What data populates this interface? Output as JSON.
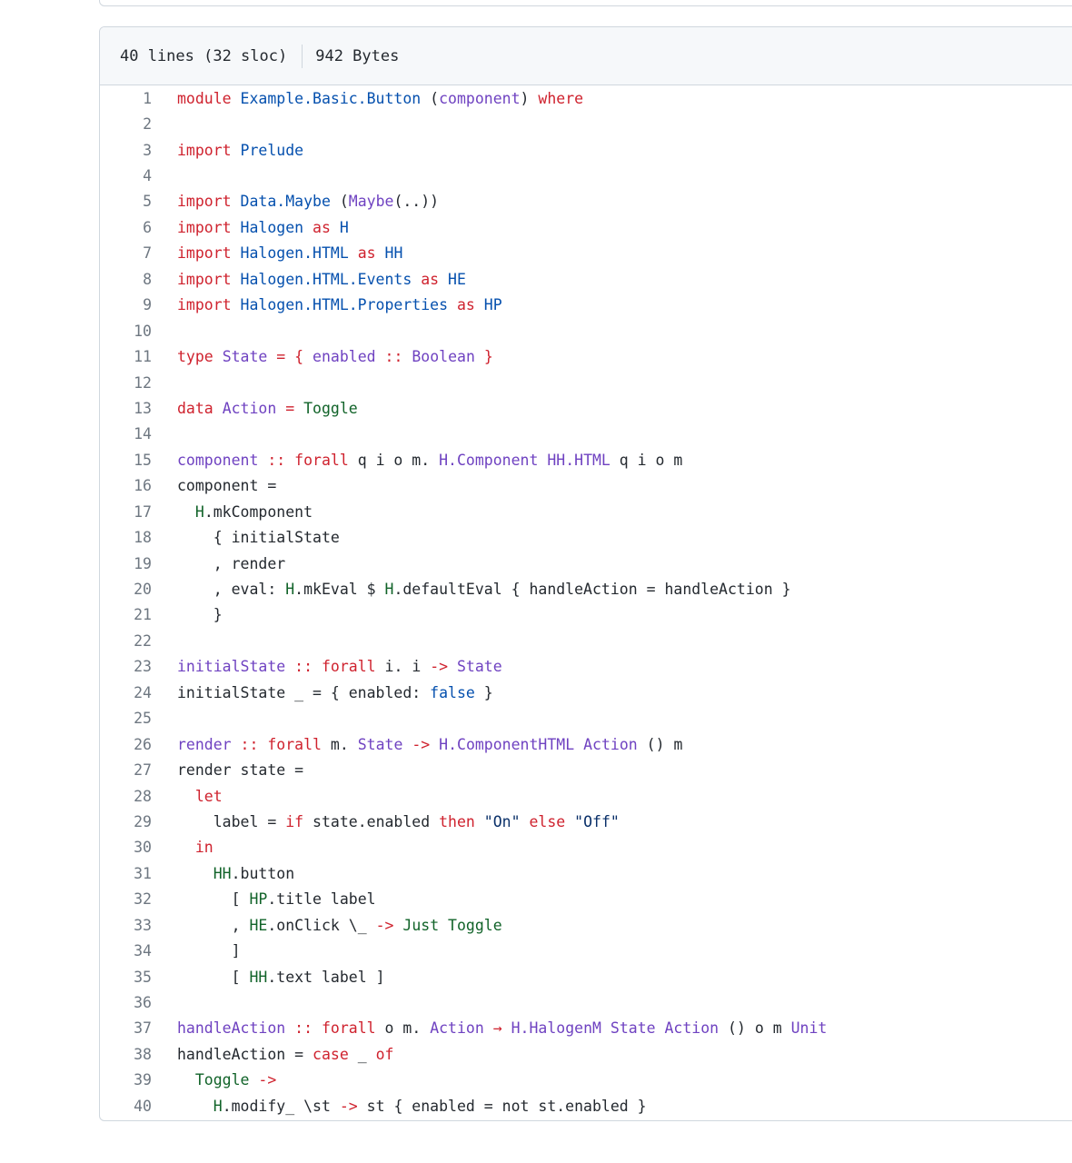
{
  "file_info": {
    "lines_text": "40 lines (32 sloc)",
    "size_text": "942 Bytes"
  },
  "colors": {
    "keyword": "#cf222e",
    "type": "#6f42c1",
    "module": "#0550ae",
    "constructor": "#116329",
    "string": "#0a3069",
    "plain": "#24292f",
    "line_number": "#6e7781"
  },
  "code_lines": [
    {
      "n": "1",
      "tokens": [
        [
          "kw",
          "module"
        ],
        [
          "pl",
          " "
        ],
        [
          "mod",
          "Example.Basic.Button"
        ],
        [
          "pl",
          " ("
        ],
        [
          "ty",
          "component"
        ],
        [
          "pl",
          ") "
        ],
        [
          "kw",
          "where"
        ]
      ]
    },
    {
      "n": "2",
      "tokens": []
    },
    {
      "n": "3",
      "tokens": [
        [
          "kw",
          "import"
        ],
        [
          "pl",
          " "
        ],
        [
          "mod",
          "Prelude"
        ]
      ]
    },
    {
      "n": "4",
      "tokens": []
    },
    {
      "n": "5",
      "tokens": [
        [
          "kw",
          "import"
        ],
        [
          "pl",
          " "
        ],
        [
          "mod",
          "Data.Maybe"
        ],
        [
          "pl",
          " ("
        ],
        [
          "ty",
          "Maybe"
        ],
        [
          "pl",
          "(..))"
        ]
      ]
    },
    {
      "n": "6",
      "tokens": [
        [
          "kw",
          "import"
        ],
        [
          "pl",
          " "
        ],
        [
          "mod",
          "Halogen"
        ],
        [
          "pl",
          " "
        ],
        [
          "kw",
          "as"
        ],
        [
          "pl",
          " "
        ],
        [
          "mod",
          "H"
        ]
      ]
    },
    {
      "n": "7",
      "tokens": [
        [
          "kw",
          "import"
        ],
        [
          "pl",
          " "
        ],
        [
          "mod",
          "Halogen.HTML"
        ],
        [
          "pl",
          " "
        ],
        [
          "kw",
          "as"
        ],
        [
          "pl",
          " "
        ],
        [
          "mod",
          "HH"
        ]
      ]
    },
    {
      "n": "8",
      "tokens": [
        [
          "kw",
          "import"
        ],
        [
          "pl",
          " "
        ],
        [
          "mod",
          "Halogen.HTML.Events"
        ],
        [
          "pl",
          " "
        ],
        [
          "kw",
          "as"
        ],
        [
          "pl",
          " "
        ],
        [
          "mod",
          "HE"
        ]
      ]
    },
    {
      "n": "9",
      "tokens": [
        [
          "kw",
          "import"
        ],
        [
          "pl",
          " "
        ],
        [
          "mod",
          "Halogen.HTML.Properties"
        ],
        [
          "pl",
          " "
        ],
        [
          "kw",
          "as"
        ],
        [
          "pl",
          " "
        ],
        [
          "mod",
          "HP"
        ]
      ]
    },
    {
      "n": "10",
      "tokens": []
    },
    {
      "n": "11",
      "tokens": [
        [
          "kw",
          "type"
        ],
        [
          "pl",
          " "
        ],
        [
          "ty",
          "State"
        ],
        [
          "pl",
          " "
        ],
        [
          "kw",
          "="
        ],
        [
          "pl",
          " "
        ],
        [
          "kw",
          "{"
        ],
        [
          "pl",
          " "
        ],
        [
          "ty",
          "enabled"
        ],
        [
          "pl",
          " "
        ],
        [
          "kw",
          "::"
        ],
        [
          "pl",
          " "
        ],
        [
          "ty",
          "Boolean"
        ],
        [
          "pl",
          " "
        ],
        [
          "kw",
          "}"
        ]
      ]
    },
    {
      "n": "12",
      "tokens": []
    },
    {
      "n": "13",
      "tokens": [
        [
          "kw",
          "data"
        ],
        [
          "pl",
          " "
        ],
        [
          "ty",
          "Action"
        ],
        [
          "pl",
          " "
        ],
        [
          "kw",
          "="
        ],
        [
          "pl",
          " "
        ],
        [
          "gr",
          "Toggle"
        ]
      ]
    },
    {
      "n": "14",
      "tokens": []
    },
    {
      "n": "15",
      "tokens": [
        [
          "ty",
          "component"
        ],
        [
          "pl",
          " "
        ],
        [
          "kw",
          "::"
        ],
        [
          "pl",
          " "
        ],
        [
          "kw",
          "forall"
        ],
        [
          "pl",
          " q i o m. "
        ],
        [
          "ty",
          "H.Component"
        ],
        [
          "pl",
          " "
        ],
        [
          "ty",
          "HH.HTML"
        ],
        [
          "pl",
          " q i o m"
        ]
      ]
    },
    {
      "n": "16",
      "tokens": [
        [
          "pl",
          "component ="
        ]
      ]
    },
    {
      "n": "17",
      "tokens": [
        [
          "pl",
          "  "
        ],
        [
          "gr",
          "H"
        ],
        [
          "pl",
          ".mkComponent"
        ]
      ]
    },
    {
      "n": "18",
      "tokens": [
        [
          "pl",
          "    { initialState"
        ]
      ]
    },
    {
      "n": "19",
      "tokens": [
        [
          "pl",
          "    , render"
        ]
      ]
    },
    {
      "n": "20",
      "tokens": [
        [
          "pl",
          "    , eval: "
        ],
        [
          "gr",
          "H"
        ],
        [
          "pl",
          ".mkEval $ "
        ],
        [
          "gr",
          "H"
        ],
        [
          "pl",
          ".defaultEval { handleAction = handleAction }"
        ]
      ]
    },
    {
      "n": "21",
      "tokens": [
        [
          "pl",
          "    }"
        ]
      ]
    },
    {
      "n": "22",
      "tokens": []
    },
    {
      "n": "23",
      "tokens": [
        [
          "ty",
          "initialState"
        ],
        [
          "pl",
          " "
        ],
        [
          "kw",
          "::"
        ],
        [
          "pl",
          " "
        ],
        [
          "kw",
          "forall"
        ],
        [
          "pl",
          " i. i "
        ],
        [
          "kw",
          "->"
        ],
        [
          "pl",
          " "
        ],
        [
          "ty",
          "State"
        ]
      ]
    },
    {
      "n": "24",
      "tokens": [
        [
          "pl",
          "initialState _ = { enabled: "
        ],
        [
          "mod",
          "false"
        ],
        [
          "pl",
          " }"
        ]
      ]
    },
    {
      "n": "25",
      "tokens": []
    },
    {
      "n": "26",
      "tokens": [
        [
          "ty",
          "render"
        ],
        [
          "pl",
          " "
        ],
        [
          "kw",
          "::"
        ],
        [
          "pl",
          " "
        ],
        [
          "kw",
          "forall"
        ],
        [
          "pl",
          " m. "
        ],
        [
          "ty",
          "State"
        ],
        [
          "pl",
          " "
        ],
        [
          "kw",
          "->"
        ],
        [
          "pl",
          " "
        ],
        [
          "ty",
          "H.ComponentHTML"
        ],
        [
          "pl",
          " "
        ],
        [
          "ty",
          "Action"
        ],
        [
          "pl",
          " () m"
        ]
      ]
    },
    {
      "n": "27",
      "tokens": [
        [
          "pl",
          "render state ="
        ]
      ]
    },
    {
      "n": "28",
      "tokens": [
        [
          "pl",
          "  "
        ],
        [
          "kw",
          "let"
        ]
      ]
    },
    {
      "n": "29",
      "tokens": [
        [
          "pl",
          "    label = "
        ],
        [
          "kw",
          "if"
        ],
        [
          "pl",
          " state.enabled "
        ],
        [
          "kw",
          "then"
        ],
        [
          "pl",
          " "
        ],
        [
          "st",
          "\"On\""
        ],
        [
          "pl",
          " "
        ],
        [
          "kw",
          "else"
        ],
        [
          "pl",
          " "
        ],
        [
          "st",
          "\"Off\""
        ]
      ]
    },
    {
      "n": "30",
      "tokens": [
        [
          "pl",
          "  "
        ],
        [
          "kw",
          "in"
        ]
      ]
    },
    {
      "n": "31",
      "tokens": [
        [
          "pl",
          "    "
        ],
        [
          "gr",
          "HH"
        ],
        [
          "pl",
          ".button"
        ]
      ]
    },
    {
      "n": "32",
      "tokens": [
        [
          "pl",
          "      [ "
        ],
        [
          "gr",
          "HP"
        ],
        [
          "pl",
          ".title label"
        ]
      ]
    },
    {
      "n": "33",
      "tokens": [
        [
          "pl",
          "      , "
        ],
        [
          "gr",
          "HE"
        ],
        [
          "pl",
          ".onClick \\_ "
        ],
        [
          "kw",
          "->"
        ],
        [
          "pl",
          " "
        ],
        [
          "gr",
          "Just Toggle"
        ]
      ]
    },
    {
      "n": "34",
      "tokens": [
        [
          "pl",
          "      ]"
        ]
      ]
    },
    {
      "n": "35",
      "tokens": [
        [
          "pl",
          "      [ "
        ],
        [
          "gr",
          "HH"
        ],
        [
          "pl",
          ".text label ]"
        ]
      ]
    },
    {
      "n": "36",
      "tokens": []
    },
    {
      "n": "37",
      "tokens": [
        [
          "ty",
          "handleAction"
        ],
        [
          "pl",
          " "
        ],
        [
          "kw",
          "::"
        ],
        [
          "pl",
          " "
        ],
        [
          "kw",
          "forall"
        ],
        [
          "pl",
          " o m. "
        ],
        [
          "ty",
          "Action"
        ],
        [
          "pl",
          " "
        ],
        [
          "kw",
          "→"
        ],
        [
          "pl",
          " "
        ],
        [
          "ty",
          "H.HalogenM"
        ],
        [
          "pl",
          " "
        ],
        [
          "ty",
          "State"
        ],
        [
          "pl",
          " "
        ],
        [
          "ty",
          "Action"
        ],
        [
          "pl",
          " () o m "
        ],
        [
          "ty",
          "Unit"
        ]
      ]
    },
    {
      "n": "38",
      "tokens": [
        [
          "pl",
          "handleAction = "
        ],
        [
          "kw",
          "case"
        ],
        [
          "pl",
          " _ "
        ],
        [
          "kw",
          "of"
        ]
      ]
    },
    {
      "n": "39",
      "tokens": [
        [
          "pl",
          "  "
        ],
        [
          "gr",
          "Toggle"
        ],
        [
          "pl",
          " "
        ],
        [
          "kw",
          "->"
        ]
      ]
    },
    {
      "n": "40",
      "tokens": [
        [
          "pl",
          "    "
        ],
        [
          "gr",
          "H"
        ],
        [
          "pl",
          ".modify_ \\st "
        ],
        [
          "kw",
          "->"
        ],
        [
          "pl",
          " st { enabled = not st.enabled }"
        ]
      ]
    }
  ]
}
